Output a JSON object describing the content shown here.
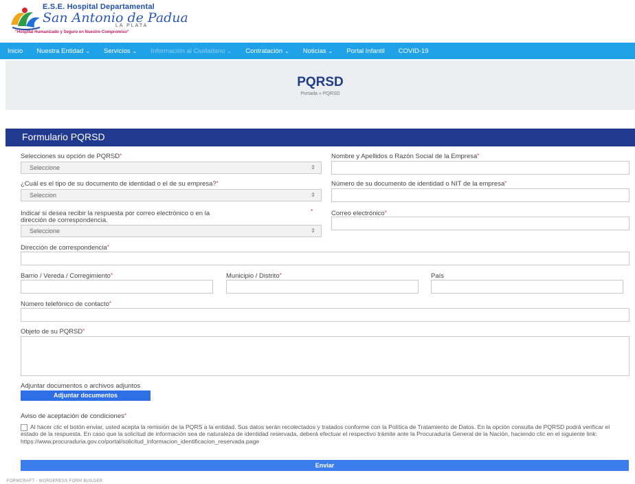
{
  "header": {
    "brand_top": "E.S.E. Hospital Departamental",
    "brand_name": "San Antonio de Padua",
    "town": "LA PLATA",
    "slogan": "\"Hospital Humanizado y Seguro en Nuestro Compromiso\""
  },
  "nav": {
    "items": [
      {
        "label": "Inicio",
        "chevron": false
      },
      {
        "label": "Nuestra Entidad",
        "chevron": true
      },
      {
        "label": "Servicios",
        "chevron": true
      },
      {
        "label": "Información al Ciudadano",
        "chevron": true
      },
      {
        "label": "Contratación",
        "chevron": true
      },
      {
        "label": "Noticias",
        "chevron": true
      },
      {
        "label": "Portal Infantil",
        "chevron": false
      },
      {
        "label": "COVID-19",
        "chevron": false
      }
    ],
    "chevron_glyph": "⌄"
  },
  "banner": {
    "title": "PQRSD",
    "breadcrumb": "Portada » PQRSD"
  },
  "form": {
    "title": "Formulario PQRSD",
    "required_mark": "*",
    "select_arrow": "⇕",
    "fields": {
      "opcion": {
        "label": "Selecciones su opción de PQRSD",
        "value": "Seleccione"
      },
      "nombre": {
        "label": "Nombre y Apellidos o Razón Social de la Empresa"
      },
      "tipo_doc": {
        "label": "¿Cuál es el tipo de su documento de identidad o el de su empresa?",
        "value": "Seleccion"
      },
      "num_doc": {
        "label": "Número de su documento de identidad o NIT de la empresa"
      },
      "respuesta": {
        "label_line1": "Indicar si desea recibir la respuesta por correo electrónico o en la",
        "label_line2": "dirección de correspondencia.",
        "value": "Seleccione"
      },
      "correo": {
        "label": "Correo electrónico"
      },
      "direccion": {
        "label": "Dirección de correspondencia"
      },
      "barrio": {
        "label": "Barrio / Vereda / Corregimiento"
      },
      "municipio": {
        "label": "Municipio / Distrito"
      },
      "pais": {
        "label": "País"
      },
      "telefono": {
        "label": "Número telefónico de contacto"
      },
      "objeto": {
        "label": "Objeto de su PQRSD"
      }
    },
    "upload": {
      "label": "Adjuntar documentos o archivos adjuntos",
      "button": "Adjuntar documentos"
    },
    "terms": {
      "label": "Aviso de aceptación de condiciones",
      "text": "Al hacer clic el botón enviar, usted acepta la remisión de la PQRS a la entidad. Sus datos serán recolectados y tratados conforme con la Política de Tratamiento de Datos. En la opción consulta de PQRSD podrá verificar el estado de la respuesta. En caso que la solicitud de información sea de naturaleza de identidad reservada, deberá efectuar el respectivo trámite ante la Procuraduría General de la Nación, haciendo clic en el siguiente link: https://www.procuraduria.gov.co/portal/solicitud_informacion_identificacion_reservada.page"
    },
    "submit": "Enviar"
  },
  "footer": {
    "note": "FORMCRAFT - WORDPRESS FORM BUILDER"
  }
}
